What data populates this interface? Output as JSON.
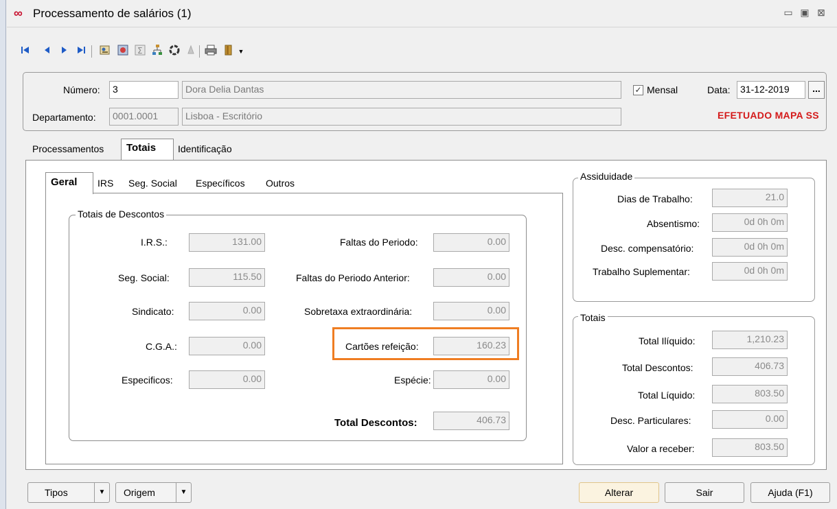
{
  "window": {
    "title": "Processamento de salários (1)",
    "logo_glyph": "∞",
    "controls": {
      "minimize": "▭",
      "restore": "▣",
      "close": "⊠"
    }
  },
  "toolbar": {
    "icons": [
      "first-record-icon",
      "previous-record-icon",
      "next-record-icon",
      "last-record-icon",
      "employee-card-icon",
      "process-icon",
      "sum-icon",
      "hierarchy-icon",
      "refresh-icon",
      "clear-icon",
      "print-icon",
      "exit-door-icon"
    ]
  },
  "header": {
    "numero_label": "Número:",
    "numero_value": "3",
    "nome_value": "Dora Delia Dantas",
    "departamento_label": "Departamento:",
    "departamento_code": "0001.0001",
    "departamento_name": "Lisboa - Escritório",
    "mensal_label": "Mensal",
    "mensal_checked": true,
    "data_label": "Data:",
    "data_value": "31-12-2019",
    "date_button": "...",
    "status": "EFETUADO MAPA SS"
  },
  "tabs": [
    "Processamentos",
    "Totais",
    "Identificação"
  ],
  "subtabs": [
    "Geral",
    "IRS",
    "Seg. Social",
    "Específicos",
    "Outros"
  ],
  "descontos": {
    "title": "Totais de Descontos",
    "irs_label": "I.R.S.:",
    "irs": "131.00",
    "seg_social_label": "Seg. Social:",
    "seg_social": "115.50",
    "sindicato_label": "Sindicato:",
    "sindicato": "0.00",
    "cga_label": "C.G.A.:",
    "cga": "0.00",
    "especificos_label": "Especificos:",
    "especificos": "0.00",
    "faltas_periodo_label": "Faltas do Periodo:",
    "faltas_periodo": "0.00",
    "faltas_anterior_label": "Faltas do Periodo Anterior:",
    "faltas_anterior": "0.00",
    "sobretaxa_label": "Sobretaxa extraordinária:",
    "sobretaxa": "0.00",
    "cartoes_label": "Cartões refeição:",
    "cartoes": "160.23",
    "especie_label": "Espécie:",
    "especie": "0.00",
    "total_label": "Total Descontos:",
    "total": "406.73"
  },
  "assiduidade": {
    "title": "Assiduidade",
    "dias_label": "Dias de Trabalho:",
    "dias": "21.0",
    "absentismo_label": "Absentismo:",
    "absentismo": "0d 0h 0m",
    "desc_comp_label": "Desc. compensatório:",
    "desc_comp": "0d 0h 0m",
    "trab_sup_label": "Trabalho Suplementar:",
    "trab_sup": "0d 0h 0m"
  },
  "totais": {
    "title": "Totais",
    "iliquido_label": "Total Ilíquido:",
    "iliquido": "1,210.23",
    "descontos_label": "Total Descontos:",
    "descontos": "406.73",
    "liquido_label": "Total Líquido:",
    "liquido": "803.50",
    "particulares_label": "Desc. Particulares:",
    "particulares": "0.00",
    "receber_label": "Valor a receber:",
    "receber": "803.50"
  },
  "buttons": {
    "tipos": "Tipos",
    "origem": "Origem",
    "alterar": "Alterar",
    "sair": "Sair",
    "ajuda": "Ajuda (F1)",
    "dropdown_glyph": "▼"
  },
  "colors": {
    "status": "#d41a1a",
    "highlight": "#ef7d22",
    "nav_blue": "#1e5bc6"
  }
}
